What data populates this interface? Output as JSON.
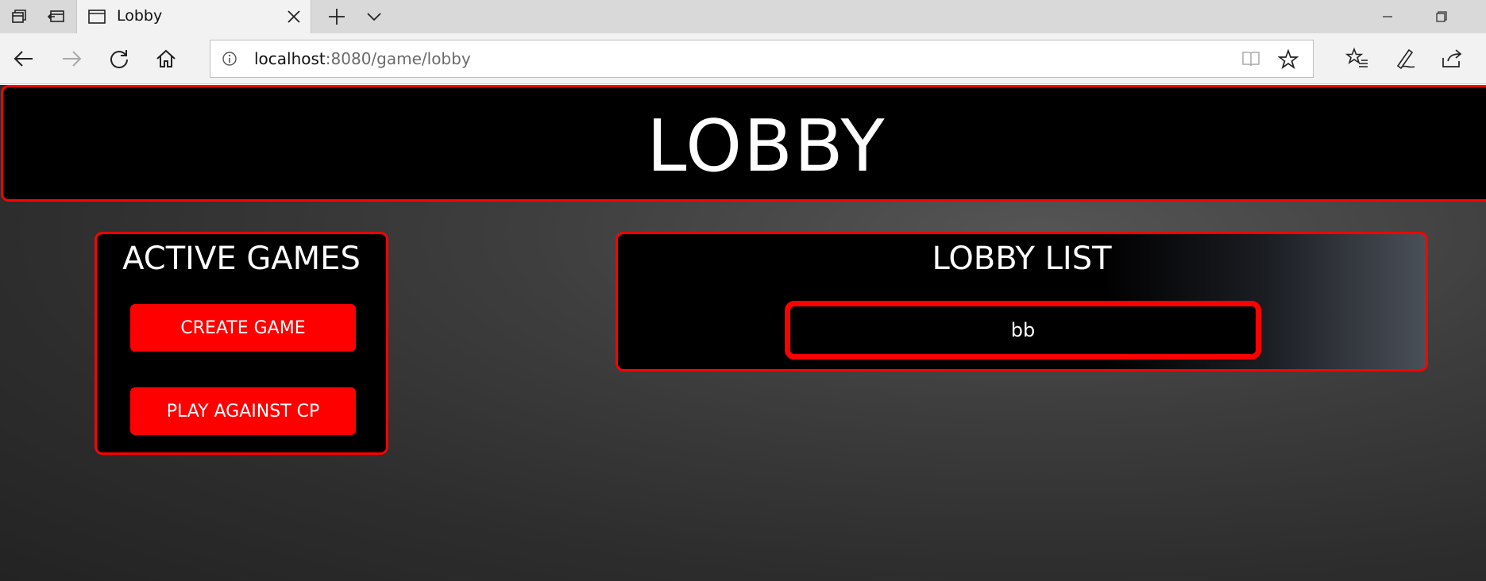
{
  "browser": {
    "tab_title": "Lobby",
    "url_host": "localhost",
    "url_rest": ":8080/game/lobby"
  },
  "page": {
    "header_title": "LOBBY",
    "active_games": {
      "title": "ACTIVE GAMES",
      "create_game_label": "CREATE GAME",
      "play_cp_label": "PLAY AGAINST CP"
    },
    "lobby_list": {
      "title": "LOBBY LIST",
      "items": [
        {
          "name": "bb"
        }
      ]
    }
  },
  "colors": {
    "accent": "#ff0000",
    "panel_bg": "#000000",
    "text": "#ffffff"
  }
}
